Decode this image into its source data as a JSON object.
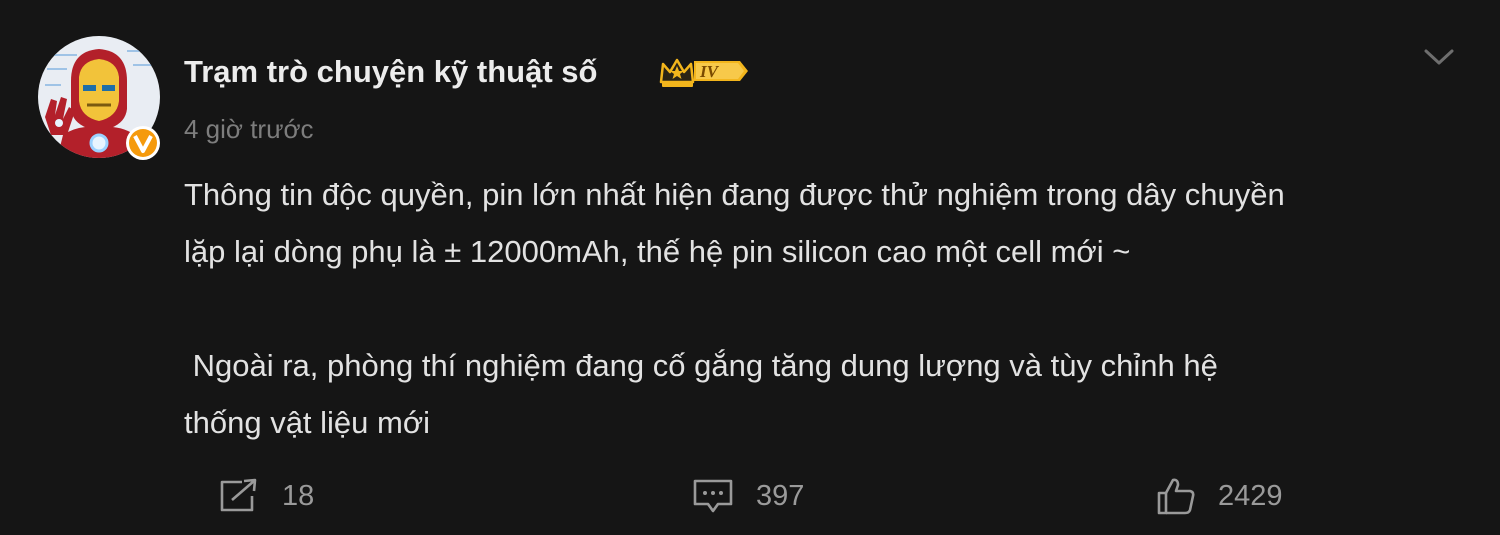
{
  "post": {
    "author": {
      "name": "Trạm trò chuyện kỹ thuật số",
      "level": "IV",
      "verified_badge": "V"
    },
    "timestamp": "4 giờ trước",
    "content": {
      "line1": "Thông tin độc quyền, pin lớn nhất hiện đang được thử nghiệm trong dây chuyền",
      "line2": "lặp lại dòng phụ là ± 12000mAh, thế hệ pin silicon cao một cell mới ~",
      "line3": " Ngoài ra, phòng thí nghiệm đang cố gắng tăng dung lượng và tùy chỉnh hệ",
      "line4": "thống vật liệu mới"
    },
    "actions": {
      "share": {
        "icon": "share-icon",
        "count": "18"
      },
      "comment": {
        "icon": "comment-icon",
        "count": "397"
      },
      "like": {
        "icon": "thumbs-up-icon",
        "count": "2429"
      }
    },
    "colors": {
      "background": "#151515",
      "text": "#e2e2e2",
      "muted": "#7d7d7d",
      "badge_gold": "#f2b51c",
      "verified_orange": "#f59a0c"
    }
  }
}
